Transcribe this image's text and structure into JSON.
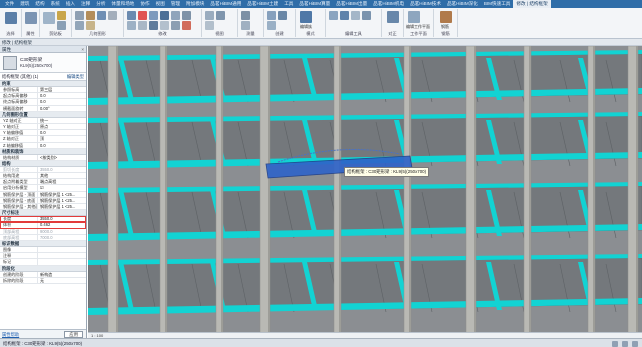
{
  "ribbon": {
    "tabs": [
      "文件",
      "建筑",
      "结构",
      "系统",
      "插入",
      "注释",
      "分析",
      "体量和场地",
      "协作",
      "视图",
      "管理",
      "附加模块",
      "品茗HiBIM通用",
      "品茗HiBIM土建",
      "工具",
      "品茗HiBIM算量",
      "品茗HiBIM出量",
      "品茗HiBIM机电",
      "品茗HiBIM技术",
      "品茗HiBIM深化",
      "BIM快速工具",
      "修改 | 结构框架"
    ],
    "active_tab": "修改 | 结构框架",
    "groups": [
      {
        "label": "选择"
      },
      {
        "label": "属性"
      },
      {
        "label": "剪贴板"
      },
      {
        "label": "几何图形"
      },
      {
        "label": "修改"
      },
      {
        "label": "视图"
      },
      {
        "label": "测量"
      },
      {
        "label": "创建"
      },
      {
        "label": "模式"
      },
      {
        "label": "编辑工具"
      },
      {
        "label": "对正"
      },
      {
        "label": "工作平面"
      },
      {
        "label": "钢筋"
      }
    ],
    "buttons": [
      {
        "label": "编辑族"
      },
      {
        "label": "编辑工作平面"
      },
      {
        "label": "钢筋"
      }
    ]
  },
  "context_bar": {
    "label": "修改 | 结构框架"
  },
  "properties": {
    "title": "属性",
    "type_name": "C30矩形梁",
    "type_sub": "KL9(5)(250x700)",
    "filter": "结构框架 (其他) (1)",
    "edit_type": "编辑类型",
    "sections": [
      {
        "name": "约束",
        "rows": [
          {
            "k": "参照标高",
            "v": "第三层",
            "state": "normal"
          },
          {
            "k": "起点标高偏移",
            "v": "0.0",
            "state": "normal"
          },
          {
            "k": "终点标高偏移",
            "v": "0.0",
            "state": "normal"
          },
          {
            "k": "横截面旋转",
            "v": "0.00°",
            "state": "normal"
          }
        ]
      },
      {
        "name": "几何图形位置",
        "rows": [
          {
            "k": "YZ 轴对正",
            "v": "统一",
            "state": "normal"
          },
          {
            "k": "Y 轴对正",
            "v": "原点",
            "state": "normal"
          },
          {
            "k": "Y 轴偏移值",
            "v": "0.0",
            "state": "normal"
          },
          {
            "k": "Z 轴对正",
            "v": "顶",
            "state": "normal"
          },
          {
            "k": "Z 轴偏移值",
            "v": "0.0",
            "state": "normal"
          }
        ]
      },
      {
        "name": "材质和装饰",
        "rows": [
          {
            "k": "结构材质",
            "v": "<按类别>",
            "state": "normal"
          }
        ]
      },
      {
        "name": "结构",
        "rows": [
          {
            "k": "剪切长度",
            "v": "3550.0",
            "state": "dim"
          },
          {
            "k": "结构用途",
            "v": "其他",
            "state": "normal"
          },
          {
            "k": "起点附着类型",
            "v": "端点高程",
            "state": "normal"
          },
          {
            "k": "启用分析模型",
            "v": "☑",
            "state": "normal"
          },
          {
            "k": "钢筋保护层 - 顶面",
            "v": "钢筋保护层 1 <25...",
            "state": "normal"
          },
          {
            "k": "钢筋保护层 - 底面",
            "v": "钢筋保护层 1 <25...",
            "state": "normal"
          },
          {
            "k": "钢筋保护层 - 其他面",
            "v": "钢筋保护层 1 <25...",
            "state": "normal"
          }
        ]
      },
      {
        "name": "尺寸标注",
        "rows": [
          {
            "k": "长度",
            "v": "3550.0",
            "state": "hl"
          },
          {
            "k": "体积",
            "v": "0.462",
            "state": "hl"
          },
          {
            "k": "顶部高程",
            "v": "9000.0",
            "state": "dim"
          },
          {
            "k": "底部高程",
            "v": "7000.0",
            "state": "dim"
          }
        ]
      },
      {
        "name": "标识数据",
        "rows": [
          {
            "k": "图像",
            "v": "",
            "state": "normal"
          },
          {
            "k": "注释",
            "v": "",
            "state": "normal"
          },
          {
            "k": "标记",
            "v": "",
            "state": "normal"
          }
        ]
      },
      {
        "name": "阶段化",
        "rows": [
          {
            "k": "创建的阶段",
            "v": "新构造",
            "state": "normal"
          },
          {
            "k": "拆除的阶段",
            "v": "无",
            "state": "normal"
          }
        ]
      }
    ],
    "help_link": "属性帮助",
    "apply_label": "应用"
  },
  "viewport": {
    "tooltip": "结构框架 : C30矩形梁 : KL9(5)(250x700)",
    "colors": {
      "slab": "#74787c",
      "beam": "#12d3d3",
      "column": "#b9b9b4",
      "selected": "#2e63c9",
      "background": "#8b8e92"
    }
  },
  "view_bar": {
    "scale": "1 : 100"
  },
  "status_bar": {
    "message": "结构框架 : C30矩形梁 : KL9(5)(250x700)"
  }
}
